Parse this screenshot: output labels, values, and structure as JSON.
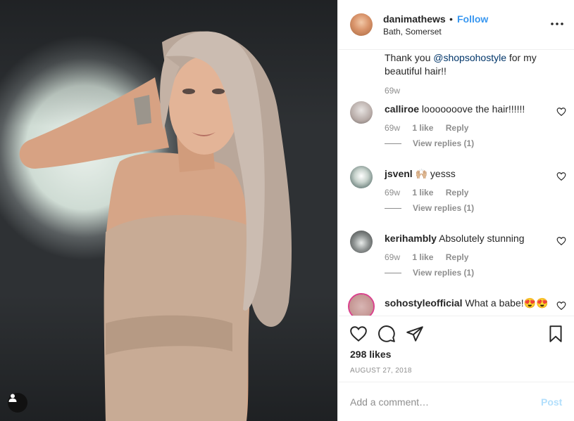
{
  "post": {
    "username": "danimathews",
    "separator": "•",
    "follow_label": "Follow",
    "location": "Bath, Somerset"
  },
  "caption": {
    "text_before": "Thank you ",
    "mention": "@shopsohostyle",
    "text_after": " for my beautiful hair!!",
    "time": "69w"
  },
  "comments": [
    {
      "user": "calliroe",
      "text": "looooooove the hair!!!!!!",
      "time": "69w",
      "likes": "1 like",
      "reply": "Reply",
      "view_replies": "View replies (1)"
    },
    {
      "user": "jsvenl",
      "text": "🙌🏼 yesss",
      "time": "69w",
      "likes": "1 like",
      "reply": "Reply",
      "view_replies": "View replies (1)"
    },
    {
      "user": "kerihambly",
      "text": "Absolutely stunning",
      "time": "69w",
      "likes": "1 like",
      "reply": "Reply",
      "view_replies": "View replies (1)"
    },
    {
      "user": "sohostyleofficial",
      "text": "What a babe!😍😍"
    }
  ],
  "stats": {
    "likes": "298 likes",
    "date": "AUGUST 27, 2018"
  },
  "add_comment": {
    "placeholder": "Add a comment…",
    "post_label": "Post"
  },
  "icons": {
    "like": "heart-icon",
    "comment": "comment-icon",
    "share": "share-icon",
    "save": "bookmark-icon",
    "more": "more-options-icon",
    "tag": "user-tag-icon"
  },
  "colors": {
    "link": "#3897f0",
    "mention": "#003569",
    "muted": "#8e8e8e",
    "post_disabled": "#b2dffc"
  }
}
